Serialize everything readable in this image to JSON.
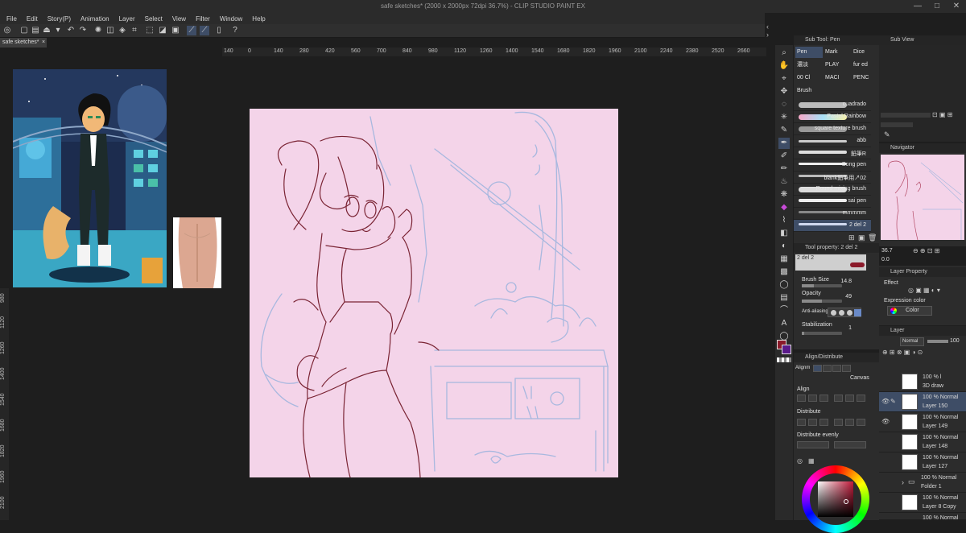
{
  "app": {
    "title": "safe sketches* (2000 x 2000px 72dpi 36.7%)  - CLIP STUDIO PAINT EX",
    "window_buttons": [
      "—",
      "□",
      "✕"
    ]
  },
  "menu": [
    "File",
    "Edit",
    "Story(P)",
    "Animation",
    "Layer",
    "Select",
    "View",
    "Filter",
    "Window",
    "Help"
  ],
  "document_tab": {
    "label": "safe sketches*",
    "close": "×"
  },
  "ruler": {
    "top": [
      "140",
      "0",
      "140",
      "280",
      "420",
      "560",
      "700",
      "840",
      "980",
      "1120",
      "1260",
      "1400",
      "1540",
      "1680",
      "1820",
      "1960",
      "2100",
      "2240",
      "2380",
      "2520",
      "2660"
    ],
    "left": [
      "980",
      "1120",
      "1260",
      "1400",
      "1540",
      "1680",
      "1820",
      "1960",
      "2100"
    ]
  },
  "subtool": {
    "header": "Sub Tool: Pen",
    "tabs": [
      "Pen",
      "Mark",
      "Dice",
      "濃淡",
      "PLAY",
      "fur ed",
      "00 Cl",
      "MACI",
      "PENC",
      "Brush"
    ],
    "brushes": [
      "cuadrado",
      "Pastel Rainbow",
      "square texture brush",
      "abb",
      "鉛筆R",
      "Bong pen",
      "blank鉛筆用↗02",
      "Round mixing brush",
      "sai pen",
      "mmmmm",
      "2 del 2"
    ]
  },
  "tool_property": {
    "header": "Tool property: 2 del 2",
    "preview_label": "2 del 2",
    "brush_size_label": "Brush Size",
    "brush_size_value": "14.8",
    "brush_size_fraction": 0.3,
    "opacity_label": "Opacity",
    "opacity_value": "49",
    "opacity_fraction": 0.49,
    "antialias_label": "Anti-aliasing",
    "stabilization_label": "Stabilization",
    "stabilization_value": "1",
    "stabilization_fraction": 0.05
  },
  "align_panel": {
    "header": "Align/Distribute",
    "alignment_label": "Alignm",
    "canvas_label": "Canvas",
    "align_label": "Align",
    "distribute_label": "Distribute",
    "distribute_evenly_label": "Distribute evenly"
  },
  "subview": {
    "header": "Sub View"
  },
  "navigator": {
    "header": "Navigator",
    "zoom": "36.7",
    "rotation": "0.0"
  },
  "layer_property": {
    "header": "Layer Property",
    "effect_label": "Effect",
    "expression_label": "Expression color",
    "color_value": "Color"
  },
  "layers": {
    "header": "Layer",
    "blend_mode": "Normal",
    "opacity": "100",
    "rows": [
      {
        "mode": "100 % l",
        "name": "3D draw",
        "active": false
      },
      {
        "mode": "100 % Normal",
        "name": "Layer 150",
        "active": true
      },
      {
        "mode": "100 % Normal",
        "name": "Layer 149",
        "active": false
      },
      {
        "mode": "100 % Normal",
        "name": "Layer 148",
        "active": false
      },
      {
        "mode": "100 % Normal",
        "name": "Layer 127",
        "active": false
      },
      {
        "mode": "100 % Normal",
        "name": "Folder 1",
        "active": false
      },
      {
        "mode": "100 % Normal",
        "name": "Layer 8 Copy",
        "active": false
      },
      {
        "mode": "100 % Normal",
        "name": "",
        "active": false
      }
    ]
  },
  "colors": {
    "canvas": "#f4d4e9",
    "sketch_line": "#7a2434",
    "sketch_blue": "#a8b8df",
    "main_color": "#8b1a2a",
    "selection": "#3e4d66"
  }
}
